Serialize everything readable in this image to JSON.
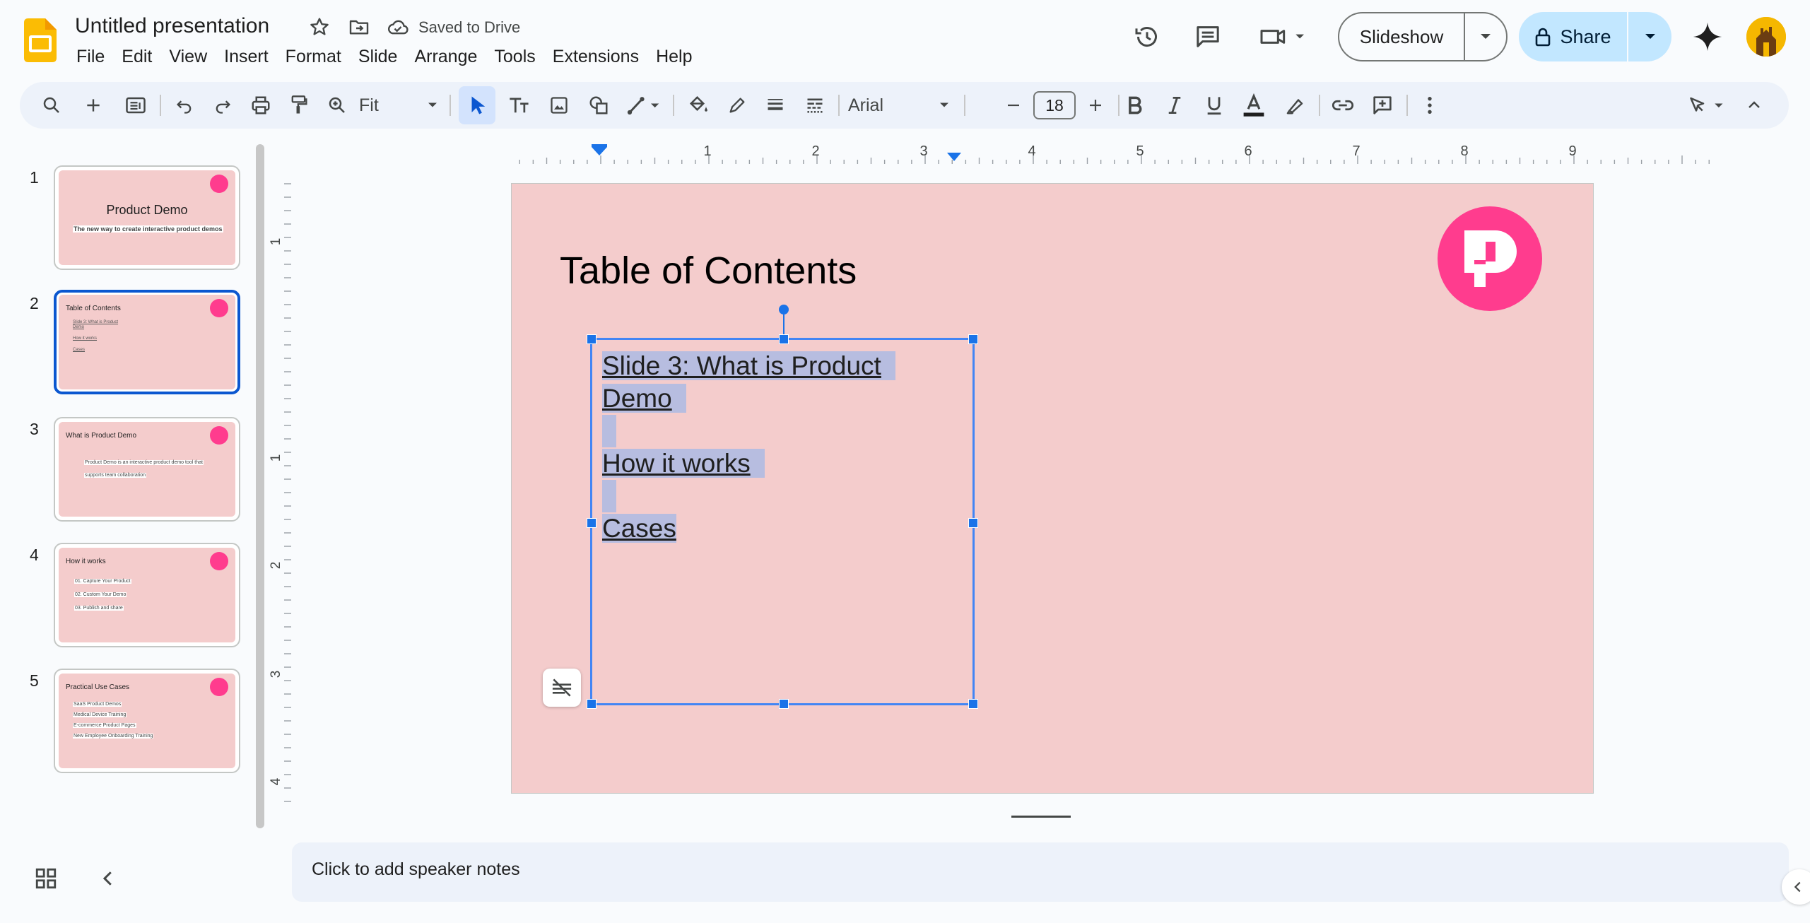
{
  "header": {
    "title": "Untitled presentation",
    "save_status": "Saved to Drive",
    "menu": [
      "File",
      "Edit",
      "View",
      "Insert",
      "Format",
      "Slide",
      "Arrange",
      "Tools",
      "Extensions",
      "Help"
    ],
    "slideshow_label": "Slideshow",
    "share_label": "Share"
  },
  "toolbar": {
    "zoom": "Fit",
    "font": "Arial",
    "font_size": "18"
  },
  "filmstrip": [
    {
      "number": "1",
      "title": "Product Demo",
      "subtitle": "The new way to create interactive product demos",
      "lines": []
    },
    {
      "number": "2",
      "title": "Table of Contents",
      "lines": [
        "Slide 3: What is Product",
        "Demo",
        "How it works",
        "Cases"
      ]
    },
    {
      "number": "3",
      "title": "What is Product Demo",
      "lines": [
        "Product Demo is an interactive product demo tool that",
        "supports team collaboration"
      ]
    },
    {
      "number": "4",
      "title": "How it works",
      "lines": [
        "01. Capture Your Product",
        "02. Custom Your Demo",
        "03. Publish and share"
      ]
    },
    {
      "number": "5",
      "title": "Practical Use Cases",
      "lines": [
        "SaaS Product Demos",
        "Medical Device Training",
        "E-commerce Product Pages",
        "New Employee Onboarding Training"
      ]
    }
  ],
  "ruler": {
    "h_ticks": [
      "1",
      "2",
      "3",
      "4",
      "5",
      "6",
      "7",
      "8",
      "9"
    ],
    "v_ticks": [
      "1",
      "1",
      "2",
      "3",
      "4"
    ]
  },
  "slide": {
    "title": "Table of Contents",
    "textbox_lines": [
      "Slide 3: What is Product",
      "Demo",
      "How it works",
      "Cases"
    ]
  },
  "notes_placeholder": "Click to add speaker notes",
  "colors": {
    "slide_bg": "#f4cccc",
    "logo_pink": "#ff3c8e",
    "selection_blue": "#1a73e8",
    "share_bg": "#c2e7ff"
  }
}
